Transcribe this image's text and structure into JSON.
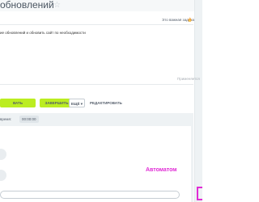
{
  "header": {
    "title": "обновлений",
    "star_icon": "star-icon"
  },
  "task": {
    "important_label": "Это важная задача",
    "important_icon": "fire-icon",
    "description": "ие обновлений и обновить сайт по необходимости",
    "move_label": "Применяется"
  },
  "actions": {
    "start_label": "ВАТЬ",
    "finish_label": "ЗАВЕРШИТЬ",
    "more_label": "ЕЩЁ",
    "edit_label": "РЕДАКТИРОВАТЬ"
  },
  "tabs": {
    "time_label": "время:",
    "time_value": "00:00:00"
  },
  "feed": {
    "automatic_label": "Автоматом"
  },
  "comment": {
    "placeholder": ""
  },
  "colors": {
    "accent_green": "#bbed21",
    "highlight_magenta": "#e02bd5",
    "background_gray": "#eef2f4"
  }
}
